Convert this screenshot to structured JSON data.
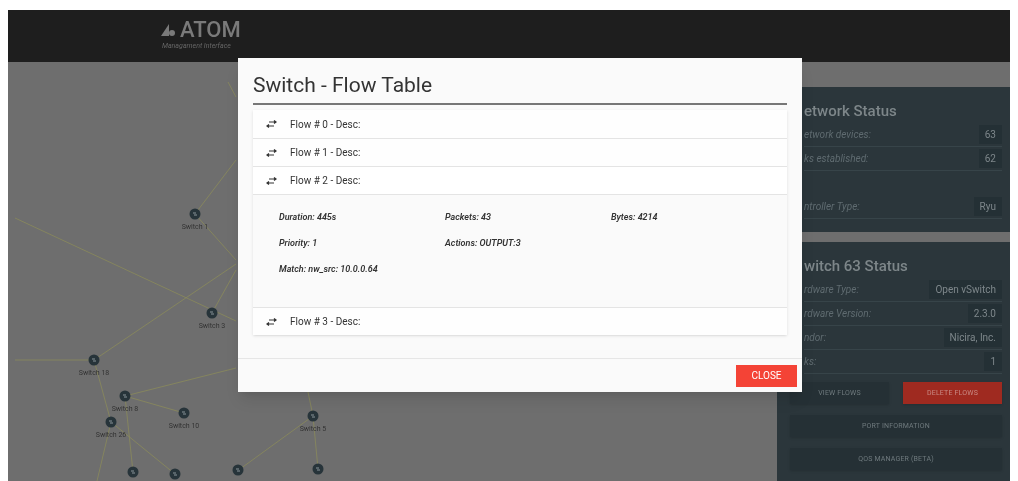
{
  "header": {
    "logo": "ATOM",
    "subtitle": "Managament Interface"
  },
  "topology": {
    "nodes": [
      {
        "label": "Switch 1"
      },
      {
        "label": "Switch 3"
      },
      {
        "label": "Switch 18"
      },
      {
        "label": "Switch 8"
      },
      {
        "label": "Switch 10"
      },
      {
        "label": "Switch 26"
      },
      {
        "label": "Switch 5"
      }
    ]
  },
  "network_status": {
    "title": "etwork Status",
    "rows": [
      {
        "label": "etwork devices:",
        "value": "63"
      },
      {
        "label": "ks established:",
        "value": "62"
      }
    ],
    "controller": {
      "label": "ntroller Type:",
      "value": "Ryu"
    }
  },
  "switch_status": {
    "title": "witch 63 Status",
    "rows": [
      {
        "label": "rdware Type:",
        "value": "Open vSwitch"
      },
      {
        "label": "rdware Version:",
        "value": "2.3.0"
      },
      {
        "label": "ndor:",
        "value": "Nicira, Inc."
      },
      {
        "label": "ks:",
        "value": "1"
      }
    ],
    "button_rows": [
      [
        {
          "label": "VIEW FLOWS",
          "kind": "normal"
        },
        {
          "label": "DELETE FLOWS",
          "kind": "danger"
        }
      ],
      [
        {
          "label": "PORT INFORMATION",
          "kind": "normal"
        }
      ],
      [
        {
          "label": "QOS MANAGER (BETA)",
          "kind": "normal"
        }
      ]
    ]
  },
  "modal": {
    "title": "Switch - Flow Table",
    "flows": [
      {
        "label": "Flow # 0 - Desc:",
        "expanded": false
      },
      {
        "label": "Flow # 1 - Desc:",
        "expanded": false
      },
      {
        "label": "Flow # 2 - Desc:",
        "expanded": true,
        "details": [
          [
            "Duration: 445s",
            "Packets: 43",
            "Bytes: 4214"
          ],
          [
            "Priority: 1",
            "Actions: OUTPUT:3"
          ],
          [
            "Match: nw_src: 10.0.0.64"
          ]
        ]
      },
      {
        "label": "Flow # 3 - Desc:",
        "expanded": false
      }
    ],
    "close_button": "CLOSE"
  }
}
